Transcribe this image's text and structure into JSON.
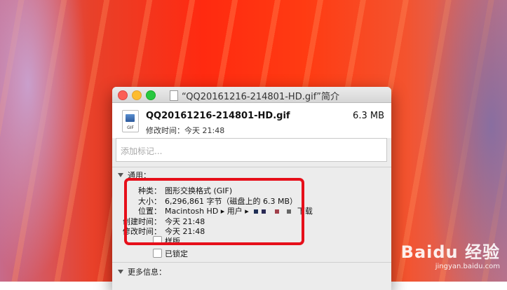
{
  "window": {
    "title": "“QQ20161216-214801-HD.gif”简介"
  },
  "file": {
    "name": "QQ20161216-214801-HD.gif",
    "modified": "修改时间：今天 21:48",
    "size": "6.3 MB",
    "icon_tag": "GIF"
  },
  "tags": {
    "placeholder": "添加标记..."
  },
  "general": {
    "header": "通用：",
    "kind_label": "种类：",
    "kind_value": "图形交换格式 (GIF)",
    "size_label": "大小：",
    "size_value": "6,296,861 字节（磁盘上的 6.3 MB）",
    "where_label": "位置：",
    "where_value": "Macintosh HD ▸ 用户 ▸",
    "where_tail": "下载",
    "created_label": "创建时间：",
    "created_value": "今天 21:48",
    "modified_label": "修改时间：",
    "modified_value": "今天 21:48",
    "stationery_label": "样版",
    "locked_label": "已锁定"
  },
  "more_info": {
    "header": "更多信息："
  },
  "watermark": {
    "brand": "Baidu 经验",
    "url": "jingyan.baidu.com"
  },
  "colors": {
    "highlight": "#e60f1a",
    "close": "#fc5f57",
    "minimize": "#fdbc2e",
    "maximize": "#28c840"
  }
}
